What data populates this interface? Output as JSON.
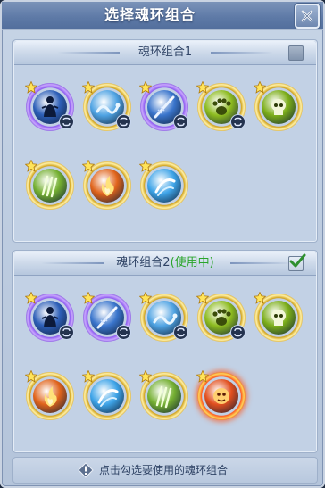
{
  "dialog": {
    "title": "选择魂环组合",
    "close_icon": "close-icon"
  },
  "combos": [
    {
      "title": "魂环组合1",
      "status": "",
      "checked": false,
      "rings": [
        {
          "name": "shadow-figure",
          "frame": "purple",
          "starred": true,
          "linked": true,
          "color": "#2d5fb8"
        },
        {
          "name": "serpent",
          "frame": "gold",
          "starred": true,
          "linked": true,
          "color": "#4fa3e3"
        },
        {
          "name": "spear",
          "frame": "purple",
          "starred": true,
          "linked": true,
          "color": "#3a75cc"
        },
        {
          "name": "paw",
          "frame": "gold",
          "starred": true,
          "linked": true,
          "color": "#8dbb1f"
        },
        {
          "name": "skull",
          "frame": "gold",
          "starred": true,
          "linked": false,
          "color": "#7cae1a"
        },
        {
          "name": "claws",
          "frame": "gold",
          "starred": true,
          "linked": false,
          "color": "#75b032"
        },
        {
          "name": "flames",
          "frame": "gold",
          "starred": true,
          "linked": false,
          "color": "#e0641c"
        },
        {
          "name": "whirlwind",
          "frame": "gold",
          "starred": true,
          "linked": false,
          "color": "#3ea4e8"
        }
      ]
    },
    {
      "title": "魂环组合2",
      "status": "(使用中)",
      "checked": true,
      "rings": [
        {
          "name": "shadow-figure",
          "frame": "purple",
          "starred": true,
          "linked": true,
          "color": "#2d5fb8"
        },
        {
          "name": "spear",
          "frame": "purple",
          "starred": true,
          "linked": true,
          "color": "#3a75cc"
        },
        {
          "name": "serpent",
          "frame": "gold",
          "starred": true,
          "linked": true,
          "color": "#4fa3e3"
        },
        {
          "name": "paw",
          "frame": "gold",
          "starred": true,
          "linked": true,
          "color": "#8dbb1f"
        },
        {
          "name": "skull",
          "frame": "gold",
          "starred": true,
          "linked": false,
          "color": "#7cae1a"
        },
        {
          "name": "flames",
          "frame": "gold",
          "starred": true,
          "linked": false,
          "color": "#e0641c"
        },
        {
          "name": "whirlwind",
          "frame": "gold",
          "starred": true,
          "linked": false,
          "color": "#3ea4e8"
        },
        {
          "name": "claws",
          "frame": "gold",
          "starred": true,
          "linked": false,
          "color": "#75b032"
        },
        {
          "name": "fire-demon",
          "frame": "fire",
          "starred": true,
          "linked": false,
          "color": "#e24f1e"
        }
      ]
    }
  ],
  "footer": {
    "icon": "warning-icon",
    "hint": "点击勾选要使用的魂环组合"
  }
}
